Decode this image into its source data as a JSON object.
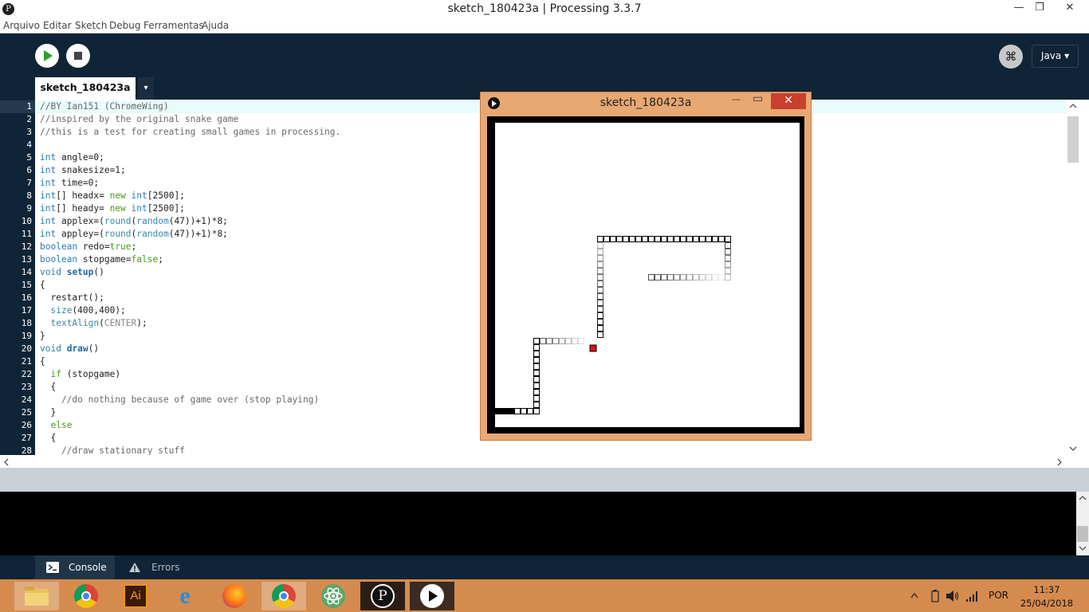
{
  "window": {
    "title": "sketch_180423a | Processing 3.3.7",
    "min": "—",
    "max": "❐",
    "close": "✕",
    "logo": "P"
  },
  "menu": [
    "Arquivo",
    "Editar",
    "Sketch",
    "Debug",
    "Ferramentas",
    "Ajuda"
  ],
  "toolbar": {
    "mode": "Java ▾",
    "mode_icon": "⌘"
  },
  "tab": {
    "name": "sketch_180423a",
    "menu": "▾"
  },
  "editor": {
    "lines": [
      "1",
      "2",
      "3",
      "4",
      "5",
      "6",
      "7",
      "8",
      "9",
      "10",
      "11",
      "12",
      "13",
      "14",
      "15",
      "16",
      "17",
      "18",
      "19",
      "20",
      "21",
      "22",
      "23",
      "24",
      "25",
      "26",
      "27",
      "28"
    ]
  },
  "code": {
    "l1": "//BY Ian151 (ChromeWing)",
    "l2": "//inspired by the original snake game",
    "l3": "//this is a test for creating small games in processing.",
    "l5a": "int",
    "l5b": " angle=0;",
    "l6a": "int",
    "l6b": " snakesize=1;",
    "l7a": "int",
    "l7b": " time=0;",
    "l8a": "int",
    "l8b": "[] headx= ",
    "l8c": "new",
    "l8d": " ",
    "l8e": "int",
    "l8f": "[2500];",
    "l9a": "int",
    "l9b": "[] heady= ",
    "l9c": "new",
    "l9d": " ",
    "l9e": "int",
    "l9f": "[2500];",
    "l10a": "int",
    "l10b": " applex=(",
    "l10c": "round",
    "l10d": "(",
    "l10e": "random",
    "l10f": "(47))+1)*8;",
    "l11a": "int",
    "l11b": " appley=(",
    "l11c": "round",
    "l11d": "(",
    "l11e": "random",
    "l11f": "(47))+1)*8;",
    "l12a": "boolean",
    "l12b": " redo=",
    "l12c": "true",
    "l12d": ";",
    "l13a": "boolean",
    "l13b": " stopgame=",
    "l13c": "false",
    "l13d": ";",
    "l14a": "void",
    "l14b": " ",
    "l14c": "setup",
    "l14d": "()",
    "l15": "{",
    "l16": "  restart();",
    "l17a": "  ",
    "l17b": "size",
    "l17c": "(400,400);",
    "l18a": "  ",
    "l18b": "textAlign",
    "l18c": "(",
    "l18d": "CENTER",
    "l18e": ");",
    "l19": "}",
    "l20a": "void",
    "l20b": " ",
    "l20c": "draw",
    "l20d": "()",
    "l21": "{",
    "l22a": "  ",
    "l22b": "if",
    "l22c": " (stopgame)",
    "l23": "  {",
    "l24": "    //do nothing because of game over (stop playing)",
    "l25": "  }",
    "l26a": "  ",
    "l26b": "else",
    "l27": "  {",
    "l28": "    //draw stationary stuff"
  },
  "footer": {
    "console": "Console",
    "errors": "Errors"
  },
  "sketch_window": {
    "title": "sketch_180423a",
    "min": "—",
    "max": "▭",
    "close": "✕"
  },
  "tray": {
    "lang": "POR",
    "time": "11:37",
    "date": "25/04/2018"
  },
  "colors": {
    "toolbar": "#0f2436",
    "play": "#2ca02c",
    "taskbar": "#d58b4d",
    "apple": "#e01010"
  }
}
